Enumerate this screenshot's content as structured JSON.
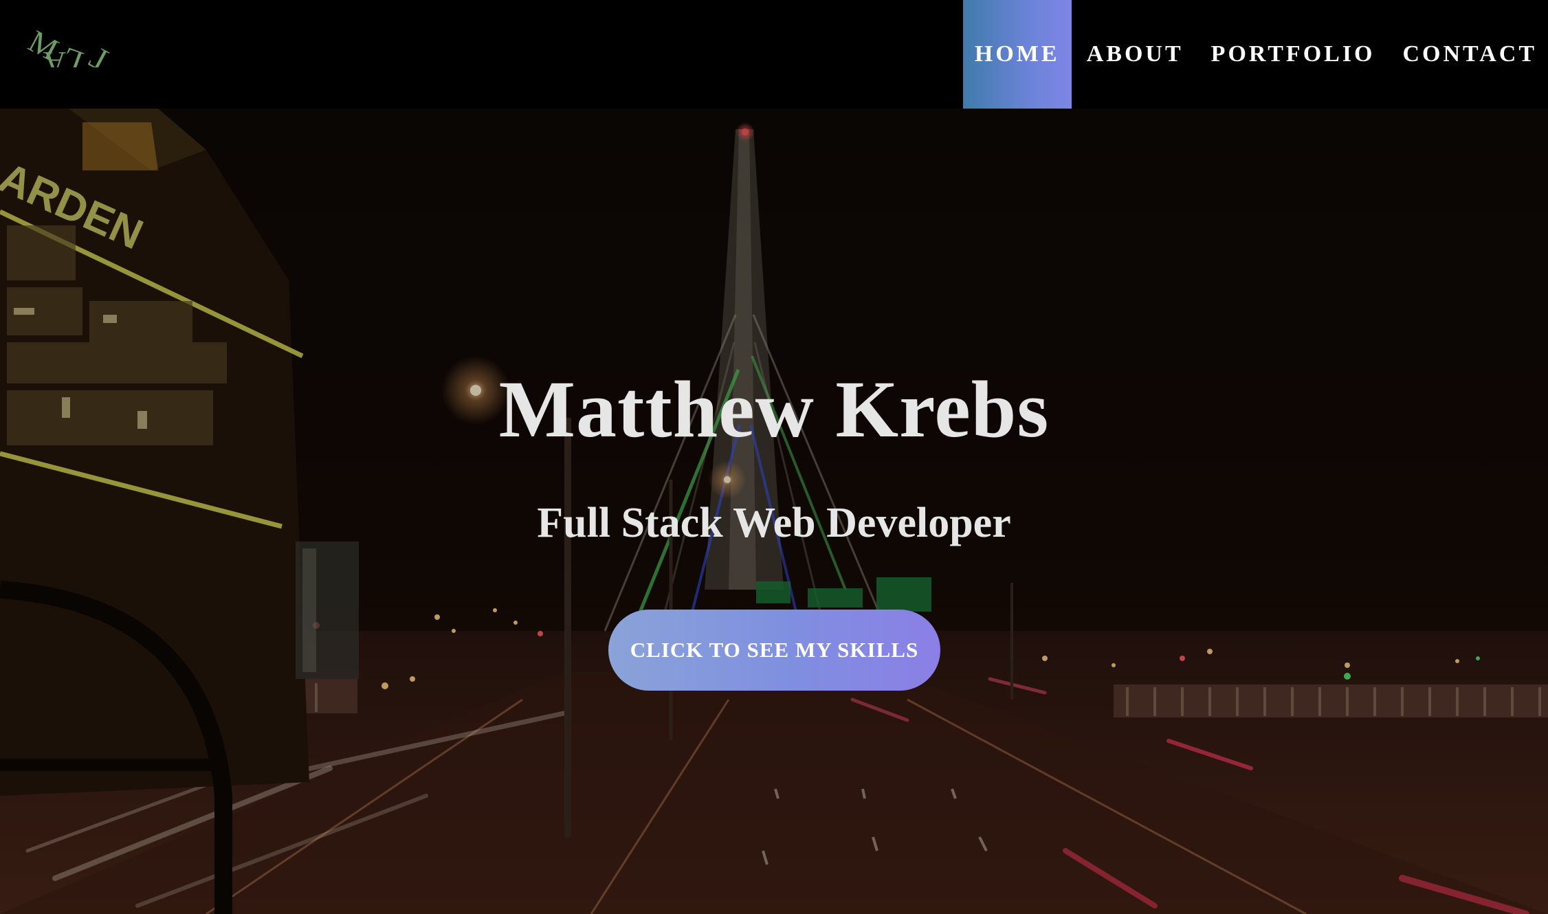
{
  "logo": {
    "text": "MALT",
    "color": "#6e9c66",
    "icon": "logo-mark"
  },
  "nav": {
    "items": [
      {
        "label": "HOME",
        "active": true
      },
      {
        "label": "ABOUT",
        "active": false
      },
      {
        "label": "PORTFOLIO",
        "active": false
      },
      {
        "label": "CONTACT",
        "active": false
      }
    ]
  },
  "hero": {
    "title": "Matthew Krebs",
    "subtitle": "Full Stack Web Developer",
    "cta_label": "CLICK TO SEE MY SKILLS",
    "background": "night-city-bridge-photo"
  },
  "colors": {
    "nav_bg": "#000000",
    "active_gradient_start": "#3f7bab",
    "active_gradient_end": "#7e86e6",
    "cta_gradient_start": "#8aa3d8",
    "cta_gradient_end": "#8b7fe6",
    "text": "#e6e6e6"
  },
  "scene_text": {
    "arena_sign": "ARDEN"
  }
}
